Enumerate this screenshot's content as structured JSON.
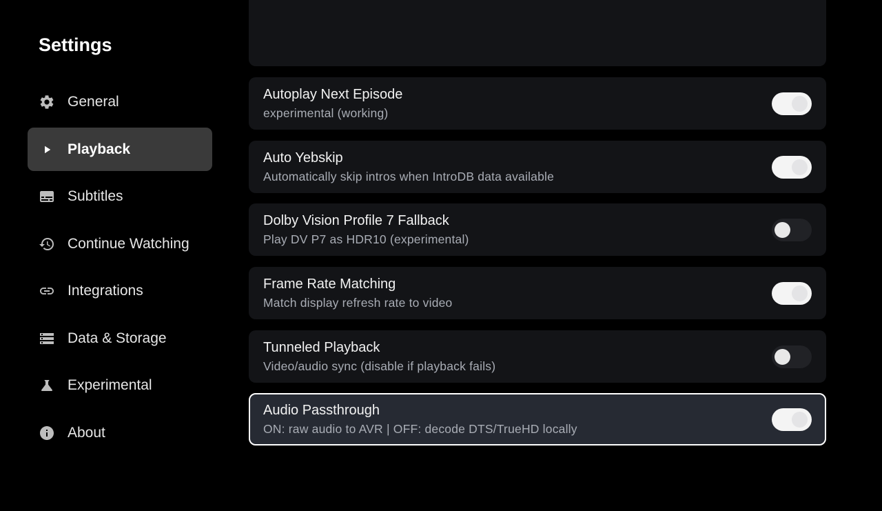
{
  "header": {
    "title": "Settings"
  },
  "sidebar": {
    "items": [
      {
        "label": "General",
        "icon": "gear-icon",
        "active": false
      },
      {
        "label": "Playback",
        "icon": "play-icon",
        "active": true
      },
      {
        "label": "Subtitles",
        "icon": "subtitles-icon",
        "active": false
      },
      {
        "label": "Continue Watching",
        "icon": "history-icon",
        "active": false
      },
      {
        "label": "Integrations",
        "icon": "link-icon",
        "active": false
      },
      {
        "label": "Data & Storage",
        "icon": "storage-icon",
        "active": false
      },
      {
        "label": "Experimental",
        "icon": "flask-icon",
        "active": false
      },
      {
        "label": "About",
        "icon": "info-icon",
        "active": false
      }
    ]
  },
  "settings": {
    "items": [
      {
        "title": "Autoplay Next Episode",
        "subtitle": "experimental (working)",
        "enabled": true,
        "focused": false
      },
      {
        "title": "Auto Yebskip",
        "subtitle": "Automatically skip intros when IntroDB data available",
        "enabled": true,
        "focused": false
      },
      {
        "title": "Dolby Vision Profile 7 Fallback",
        "subtitle": "Play DV P7 as HDR10 (experimental)",
        "enabled": false,
        "focused": false
      },
      {
        "title": "Frame Rate Matching",
        "subtitle": "Match display refresh rate to video",
        "enabled": true,
        "focused": false
      },
      {
        "title": "Tunneled Playback",
        "subtitle": "Video/audio sync (disable if playback fails)",
        "enabled": false,
        "focused": false
      },
      {
        "title": "Audio Passthrough",
        "subtitle": "ON: raw audio to AVR | OFF: decode DTS/TrueHD locally",
        "enabled": true,
        "focused": true
      }
    ]
  },
  "colors": {
    "background": "#000000",
    "card": "#131417",
    "card_focused": "#262a33",
    "sidebar_active": "#3a3a3a",
    "subtitle_text": "#a9adb5"
  }
}
